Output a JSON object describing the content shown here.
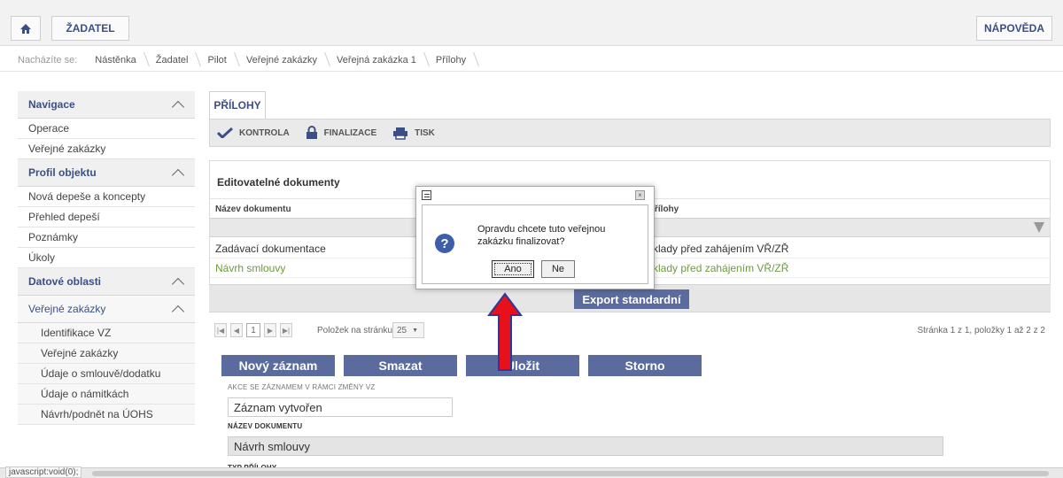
{
  "header": {
    "role_label": "ŽADATEL",
    "help_label": "NÁPOVĚDA",
    "home_icon": "home-icon"
  },
  "breadcrumb": {
    "lead": "Nacházíte se:",
    "items": [
      "Nástěnka",
      "Žadatel",
      "Pilot",
      "Veřejné zakázky",
      "Veřejná zakázka 1",
      "Přílohy"
    ]
  },
  "sidebar": {
    "nav_head": "Navigace",
    "nav_items": [
      "Operace",
      "Veřejné zakázky"
    ],
    "profil_head": "Profil objektu",
    "profil_items": [
      "Nová depeše a koncepty",
      "Přehled depeší",
      "Poznámky",
      "Úkoly"
    ],
    "datove_head": "Datové oblasti",
    "vz_head": "Veřejné zakázky",
    "vz_items": [
      "Identifikace VZ",
      "Veřejné zakázky",
      "Údaje o smlouvě/dodatku",
      "Údaje o námitkách",
      "Návrh/podnět na ÚOHS"
    ]
  },
  "main": {
    "tab_label": "PŘÍLOHY",
    "toolbar": {
      "kontrola": "KONTROLA",
      "finalizace": "FINALIZACE",
      "tisk": "TISK"
    },
    "section_title": "Editovatelné dokumenty",
    "columns": [
      "Název dokumentu",
      "Typ přílohy"
    ],
    "col2_visible": "řílohy",
    "rows": [
      {
        "name": "Zadávací dokumentace",
        "type": "klady před zahájením VŘ/ZŘ"
      },
      {
        "name": "Návrh smlouvy",
        "type": "klady před zahájením VŘ/ZŘ"
      }
    ],
    "export_label": "Export standardní",
    "pager": {
      "first": "|◀",
      "prev": "◀",
      "current": "1",
      "next": "▶",
      "last": "▶|",
      "per_page_label": "Položek na stránku",
      "per_page": "25",
      "info": "Stránka 1 z 1, položky 1 až 2 z 2"
    },
    "form_buttons": {
      "new": "Nový záznam",
      "delete": "Smazat",
      "save": "Uložit",
      "cancel": "Storno"
    },
    "form": {
      "akce_label": "AKCE SE ZÁZNAMEM V RÁMCI ZMĚNY VZ",
      "akce_value": "Záznam vytvořen",
      "nazev_label": "NÁZEV DOKUMENTU",
      "nazev_value": "Návrh smlouvy",
      "typ_label": "TYP PŘÍLOHY"
    }
  },
  "dialog": {
    "message": "Opravdu chcete tuto veřejnou zakázku finalizovat?",
    "yes": "Ano",
    "no": "Ne",
    "close": "×",
    "icon": "question-icon"
  },
  "statusbar": {
    "text": "javascript:void(0);"
  },
  "colors": {
    "accent": "#3a4f86",
    "button": "#5b6b9e",
    "link_green": "#6b9d3a",
    "arrow_red": "#e8101a",
    "arrow_outline": "#2a3a9a"
  }
}
